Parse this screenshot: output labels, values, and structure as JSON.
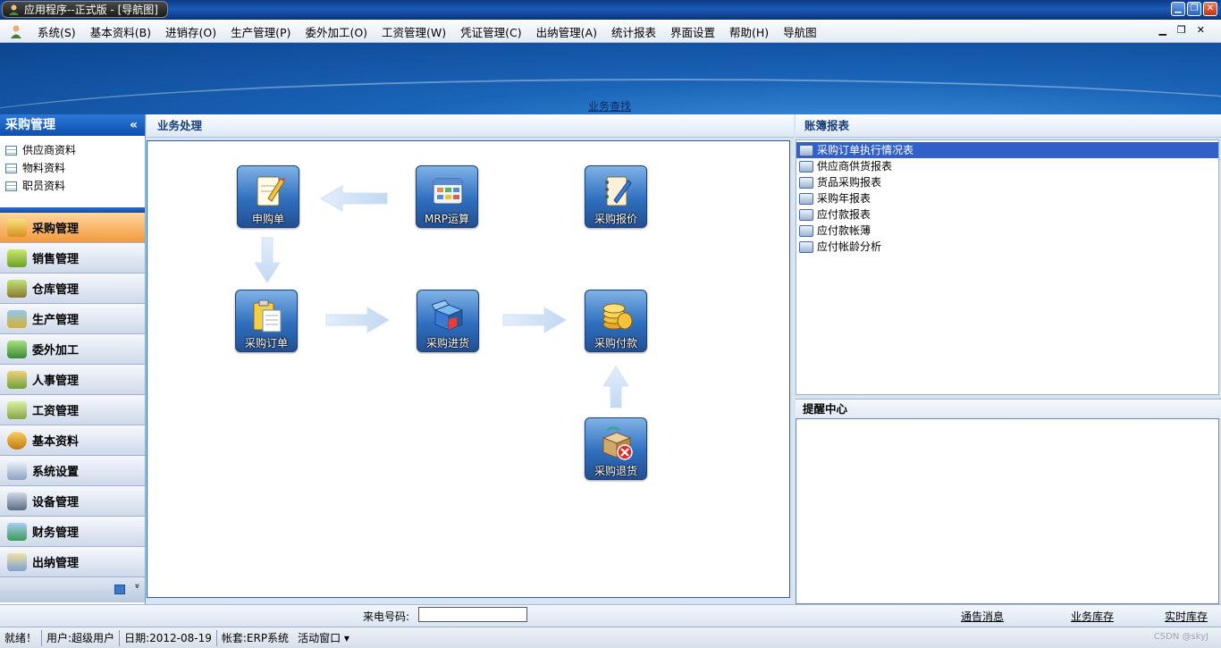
{
  "window": {
    "title": "应用程序--正式版 - [导航图]",
    "controls": {
      "minimize": "▁",
      "restore": "❐",
      "close": "✕"
    }
  },
  "menu": {
    "items": [
      "系统(S)",
      "基本资料(B)",
      "进销存(O)",
      "生产管理(P)",
      "委外加工(O)",
      "工资管理(W)",
      "凭证管理(C)",
      "出纳管理(A)",
      "统计报表",
      "界面设置",
      "帮助(H)",
      "导航图"
    ],
    "mdi": {
      "minimize": "▁",
      "restore": "❐",
      "close": "✕"
    }
  },
  "banner": {
    "link": "业务查找"
  },
  "leftnav": {
    "header": "采购管理",
    "collapse": "«",
    "sub_items": [
      "供应商资料",
      "物料资料",
      "职员资料"
    ],
    "modules": [
      "采购管理",
      "销售管理",
      "仓库管理",
      "生产管理",
      "委外加工",
      "人事管理",
      "工资管理",
      "基本资料",
      "系统设置",
      "设备管理",
      "财务管理",
      "出纳管理"
    ],
    "more": "»"
  },
  "center": {
    "header": "业务处理",
    "nodes": {
      "request": "申购单",
      "mrp": "MRP运算",
      "quote": "采购报价",
      "order": "采购订单",
      "receipt": "采购进货",
      "payment": "采购付款",
      "return": "采购退货"
    }
  },
  "right": {
    "header": "账簿报表",
    "reports": [
      "采购订单执行情况表",
      "供应商供货报表",
      "货品采购报表",
      "采购年报表",
      "应付款报表",
      "应付款帐薄",
      "应付帐龄分析"
    ],
    "selected_index": 0,
    "reminder_header": "提醒中心"
  },
  "bottom": {
    "phone_label": "来电号码:",
    "phone_value": "",
    "links": [
      "通告消息",
      "业务库存",
      "实时库存"
    ]
  },
  "status": {
    "ready": "就绪！",
    "user": "用户:超级用户",
    "date": "日期:2012-08-19",
    "account": "帐套:ERP系统",
    "active_window": "活动窗口 ▾",
    "watermark": "CSDN @skyJ"
  },
  "colors": {
    "title_bar": "#1a5bb8",
    "nav_active": "#f39a3c",
    "node_blue": "#2f6fbf",
    "selection": "#3160c9"
  },
  "icons": {
    "app": "person-icon",
    "report_item": "report-window-icon",
    "sub_item": "table-icon"
  }
}
